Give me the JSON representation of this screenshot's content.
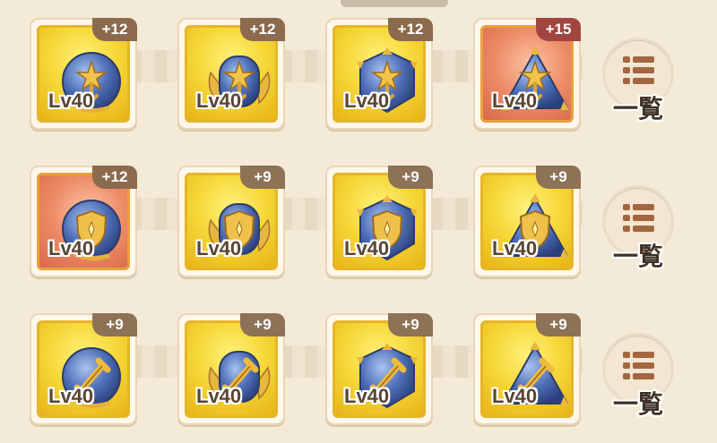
{
  "rows": [
    {
      "items": [
        {
          "level": "Lv40",
          "plus": "+12",
          "frame": "gold",
          "emblem": "star",
          "shape": "orb"
        },
        {
          "level": "Lv40",
          "plus": "+12",
          "frame": "gold",
          "emblem": "star",
          "shape": "winged"
        },
        {
          "level": "Lv40",
          "plus": "+12",
          "frame": "gold",
          "emblem": "star",
          "shape": "hexagon"
        },
        {
          "level": "Lv40",
          "plus": "+15",
          "frame": "red",
          "emblem": "star",
          "shape": "triangle"
        }
      ],
      "list_label": "一覧"
    },
    {
      "items": [
        {
          "level": "Lv40",
          "plus": "+12",
          "frame": "red",
          "emblem": "shield",
          "shape": "orb"
        },
        {
          "level": "Lv40",
          "plus": "+9",
          "frame": "gold",
          "emblem": "shield",
          "shape": "winged"
        },
        {
          "level": "Lv40",
          "plus": "+9",
          "frame": "gold",
          "emblem": "shield",
          "shape": "hexagon"
        },
        {
          "level": "Lv40",
          "plus": "+9",
          "frame": "gold",
          "emblem": "shield",
          "shape": "triangle"
        }
      ],
      "list_label": "一覧"
    },
    {
      "items": [
        {
          "level": "Lv40",
          "plus": "+9",
          "frame": "gold",
          "emblem": "sword",
          "shape": "orb"
        },
        {
          "level": "Lv40",
          "plus": "+9",
          "frame": "gold",
          "emblem": "sword",
          "shape": "winged"
        },
        {
          "level": "Lv40",
          "plus": "+9",
          "frame": "gold",
          "emblem": "sword",
          "shape": "hexagon"
        },
        {
          "level": "Lv40",
          "plus": "+9",
          "frame": "gold",
          "emblem": "sword",
          "shape": "triangle"
        }
      ],
      "list_label": "一覧"
    }
  ],
  "icons": {
    "list": "list-icon"
  },
  "colors": {
    "gold_frame": "#f6d83a",
    "red_frame": "#ec8b66",
    "gem_blue": "#4a6fb5",
    "emblem_gold": "#e9b93a"
  }
}
